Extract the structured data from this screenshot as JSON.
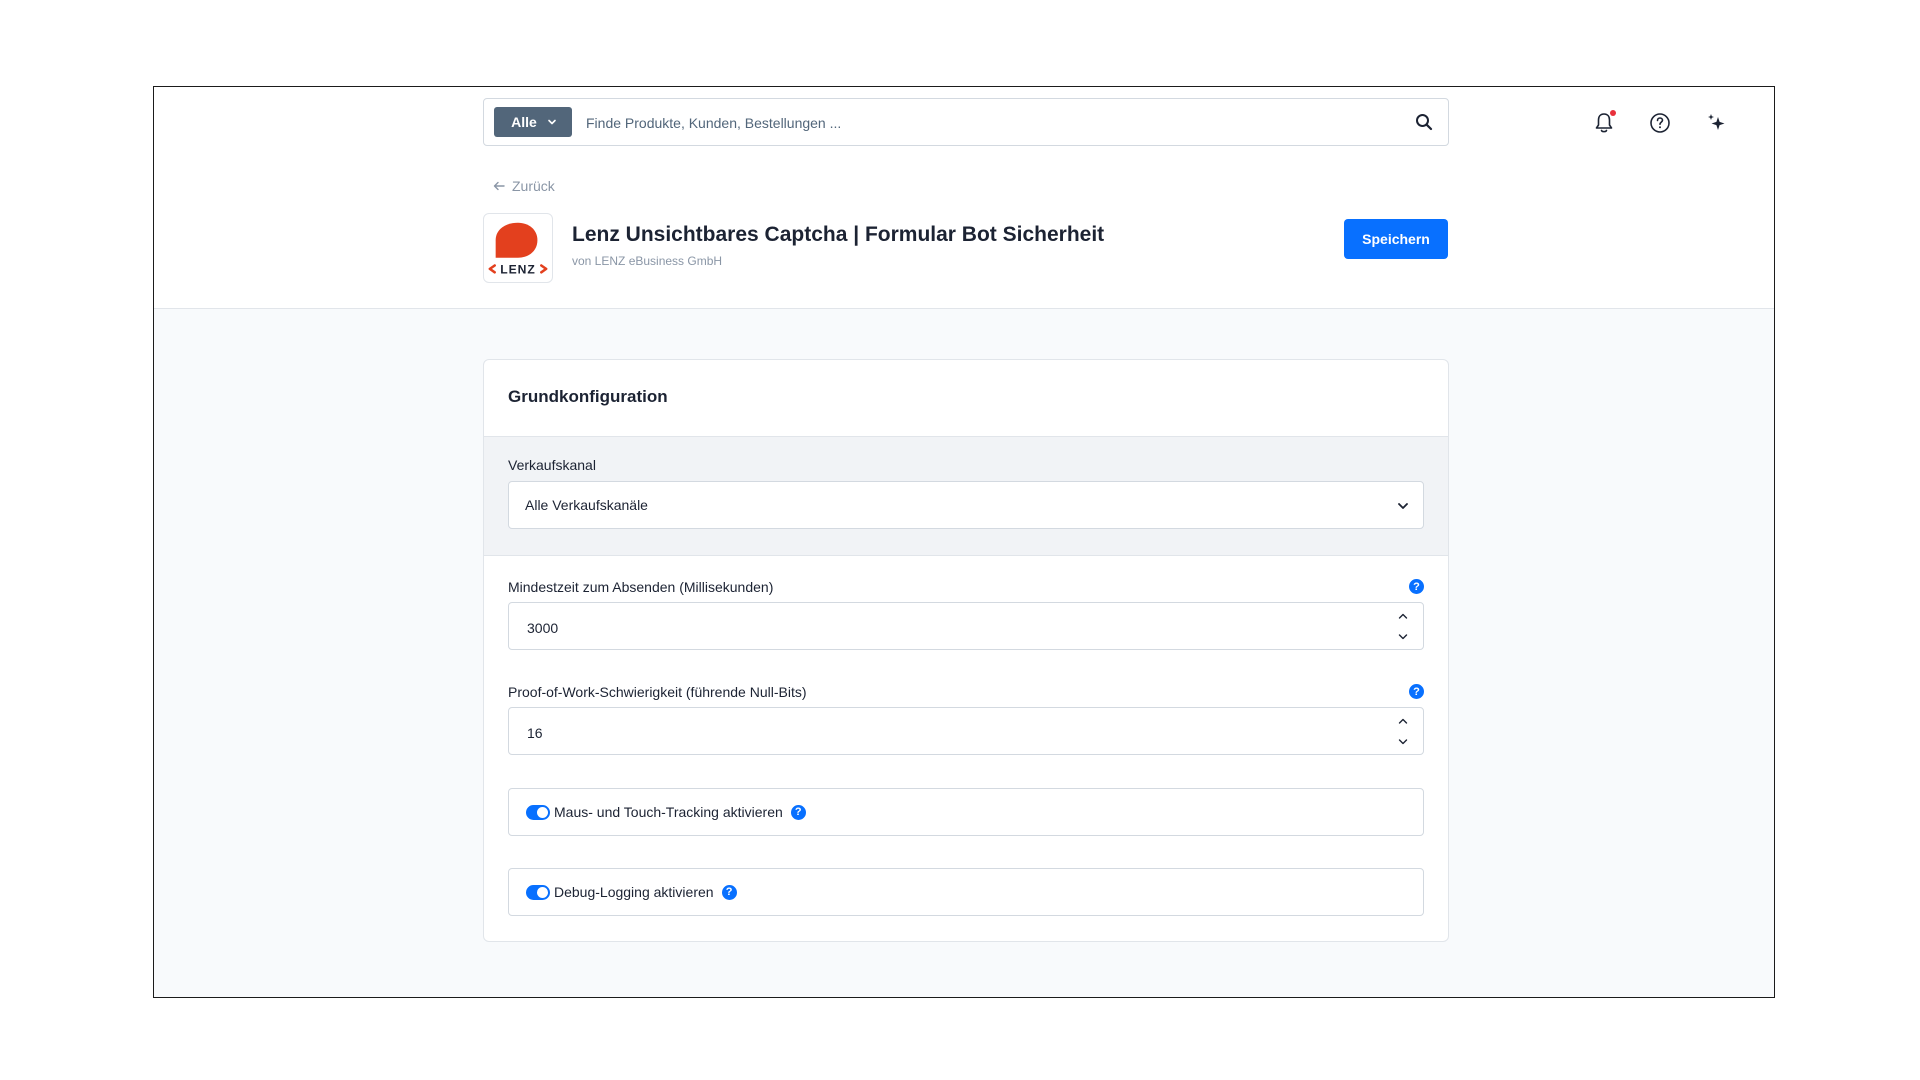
{
  "topbar": {
    "search_scope": "Alle",
    "search_placeholder": "Finde Produkte, Kunden, Bestellungen ..."
  },
  "header": {
    "back_label": "Zurück",
    "app_title": "Lenz Unsichtbares Captcha | Formular Bot Sicherheit",
    "app_vendor": "von LENZ eBusiness GmbH",
    "save_label": "Speichern",
    "logo_text": "LENZ"
  },
  "card": {
    "title": "Grundkonfiguration",
    "sales_channel": {
      "label": "Verkaufskanal",
      "value": "Alle Verkaufskanäle"
    },
    "min_time": {
      "label": "Mindestzeit zum Absenden (Millisekunden)",
      "value": "3000"
    },
    "pow": {
      "label": "Proof-of-Work-Schwierigkeit (führende Null-Bits)",
      "value": "16"
    },
    "tracking": {
      "label": "Maus- und Touch-Tracking aktivieren",
      "enabled": true
    },
    "debug": {
      "label": "Debug-Logging aktivieren",
      "enabled": true
    },
    "help_glyph": "?"
  },
  "colors": {
    "primary": "#0870ff",
    "scope_bg": "#52667a",
    "notification_dot": "#e8303c",
    "logo_red": "#e3401e"
  },
  "icons": [
    "chevron-down-icon",
    "search-icon",
    "bell-icon",
    "help-circle-icon",
    "sparkles-icon",
    "arrow-left-icon",
    "chevron-up-icon",
    "help-icon"
  ]
}
